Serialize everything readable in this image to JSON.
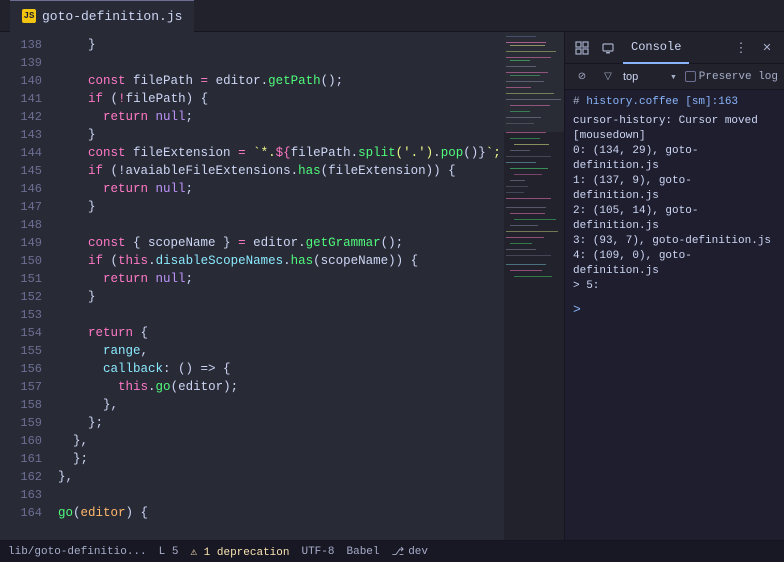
{
  "titlebar": {
    "tab_icon": "JS",
    "tab_label": "goto-definition.js"
  },
  "editor": {
    "lines": [
      {
        "num": 138,
        "tokens": [
          {
            "t": "    }",
            "c": "cb"
          }
        ]
      },
      {
        "num": 139,
        "tokens": []
      },
      {
        "num": 140,
        "tokens": [
          {
            "t": "    ",
            "c": ""
          },
          {
            "t": "const",
            "c": "kw"
          },
          {
            "t": " filePath ",
            "c": "var"
          },
          {
            "t": "=",
            "c": "op"
          },
          {
            "t": " editor",
            "c": "var"
          },
          {
            "t": ".",
            "c": "punc"
          },
          {
            "t": "getPath",
            "c": "fn"
          },
          {
            "t": "();",
            "c": "punc"
          }
        ]
      },
      {
        "num": 141,
        "tokens": [
          {
            "t": "    ",
            "c": ""
          },
          {
            "t": "if",
            "c": "kw"
          },
          {
            "t": " (",
            "c": "punc"
          },
          {
            "t": "!",
            "c": "op"
          },
          {
            "t": "filePath",
            "c": "var"
          },
          {
            "t": ") {",
            "c": "punc"
          }
        ]
      },
      {
        "num": 142,
        "tokens": [
          {
            "t": "      ",
            "c": ""
          },
          {
            "t": "return",
            "c": "kw"
          },
          {
            "t": " null",
            "c": "bool"
          },
          {
            "t": ";",
            "c": "punc"
          }
        ]
      },
      {
        "num": 143,
        "tokens": [
          {
            "t": "    }",
            "c": "cb"
          }
        ]
      },
      {
        "num": 144,
        "tokens": [
          {
            "t": "    ",
            "c": ""
          },
          {
            "t": "const",
            "c": "kw"
          },
          {
            "t": " fileExtension ",
            "c": "var"
          },
          {
            "t": "=",
            "c": "op"
          },
          {
            "t": " `*.",
            "c": "str"
          },
          {
            "t": "${",
            "c": "op"
          },
          {
            "t": "filePath",
            "c": "var"
          },
          {
            "t": ".",
            "c": "punc"
          },
          {
            "t": "split",
            "c": "fn"
          },
          {
            "t": "('.')",
            "c": "str"
          },
          {
            "t": ".",
            "c": "punc"
          },
          {
            "t": "pop",
            "c": "fn"
          },
          {
            "t": "()}",
            "c": "punc"
          },
          {
            "t": "`;",
            "c": "str"
          }
        ]
      },
      {
        "num": 145,
        "tokens": [
          {
            "t": "    ",
            "c": ""
          },
          {
            "t": "if",
            "c": "kw"
          },
          {
            "t": " (!",
            "c": "punc"
          },
          {
            "t": "avaiableFileExtensions",
            "c": "var"
          },
          {
            "t": ".",
            "c": "punc"
          },
          {
            "t": "has",
            "c": "fn"
          },
          {
            "t": "(",
            "c": "punc"
          },
          {
            "t": "fileExtension",
            "c": "var"
          },
          {
            "t": ")) {",
            "c": "punc"
          }
        ]
      },
      {
        "num": 146,
        "tokens": [
          {
            "t": "      ",
            "c": ""
          },
          {
            "t": "return",
            "c": "kw"
          },
          {
            "t": " null",
            "c": "bool"
          },
          {
            "t": ";",
            "c": "punc"
          }
        ]
      },
      {
        "num": 147,
        "tokens": [
          {
            "t": "    }",
            "c": "cb"
          }
        ]
      },
      {
        "num": 148,
        "tokens": []
      },
      {
        "num": 149,
        "tokens": [
          {
            "t": "    ",
            "c": ""
          },
          {
            "t": "const",
            "c": "kw"
          },
          {
            "t": " { scopeName } ",
            "c": "var"
          },
          {
            "t": "=",
            "c": "op"
          },
          {
            "t": " editor",
            "c": "var"
          },
          {
            "t": ".",
            "c": "punc"
          },
          {
            "t": "getGrammar",
            "c": "fn"
          },
          {
            "t": "();",
            "c": "punc"
          }
        ]
      },
      {
        "num": 150,
        "tokens": [
          {
            "t": "    ",
            "c": ""
          },
          {
            "t": "if",
            "c": "kw"
          },
          {
            "t": " (",
            "c": "punc"
          },
          {
            "t": "this",
            "c": "this-kw"
          },
          {
            "t": ".",
            "c": "punc"
          },
          {
            "t": "disableScopeNames",
            "c": "prop"
          },
          {
            "t": ".",
            "c": "punc"
          },
          {
            "t": "has",
            "c": "fn"
          },
          {
            "t": "(",
            "c": "punc"
          },
          {
            "t": "scopeName",
            "c": "var"
          },
          {
            "t": ")) {",
            "c": "punc"
          }
        ]
      },
      {
        "num": 151,
        "tokens": [
          {
            "t": "      ",
            "c": ""
          },
          {
            "t": "return",
            "c": "kw"
          },
          {
            "t": " null",
            "c": "bool"
          },
          {
            "t": ";",
            "c": "punc"
          }
        ]
      },
      {
        "num": 152,
        "tokens": [
          {
            "t": "    }",
            "c": "cb"
          }
        ]
      },
      {
        "num": 153,
        "tokens": []
      },
      {
        "num": 154,
        "tokens": [
          {
            "t": "    ",
            "c": ""
          },
          {
            "t": "return",
            "c": "kw"
          },
          {
            "t": " {",
            "c": "cb"
          }
        ]
      },
      {
        "num": 155,
        "tokens": [
          {
            "t": "      ",
            "c": ""
          },
          {
            "t": "range",
            "c": "prop"
          },
          {
            "t": ",",
            "c": "punc"
          }
        ]
      },
      {
        "num": 156,
        "tokens": [
          {
            "t": "      ",
            "c": ""
          },
          {
            "t": "callback",
            "c": "prop"
          },
          {
            "t": ": () => {",
            "c": "punc"
          }
        ]
      },
      {
        "num": 157,
        "tokens": [
          {
            "t": "        ",
            "c": ""
          },
          {
            "t": "this",
            "c": "this-kw"
          },
          {
            "t": ".",
            "c": "punc"
          },
          {
            "t": "go",
            "c": "fn"
          },
          {
            "t": "(",
            "c": "punc"
          },
          {
            "t": "editor",
            "c": "var"
          },
          {
            "t": ");",
            "c": "punc"
          }
        ]
      },
      {
        "num": 158,
        "tokens": [
          {
            "t": "      ",
            "c": ""
          },
          {
            "t": "},",
            "c": "cb"
          }
        ]
      },
      {
        "num": 159,
        "tokens": [
          {
            "t": "    ",
            "c": ""
          },
          {
            "t": "};",
            "c": "cb"
          }
        ]
      },
      {
        "num": 160,
        "tokens": [
          {
            "t": "  ",
            "c": ""
          },
          {
            "t": "},",
            "c": "cb"
          }
        ]
      },
      {
        "num": 161,
        "tokens": [
          {
            "t": "  ",
            "c": ""
          },
          {
            "t": "};",
            "c": "cb"
          }
        ]
      },
      {
        "num": 162,
        "tokens": [
          {
            "t": "},",
            "c": "cb"
          }
        ]
      },
      {
        "num": 163,
        "tokens": []
      },
      {
        "num": 164,
        "tokens": [
          {
            "t": "go",
            "c": "fn"
          },
          {
            "t": "(",
            "c": "punc"
          },
          {
            "t": "editor",
            "c": "param"
          },
          {
            "t": ") {",
            "c": "punc"
          }
        ]
      }
    ]
  },
  "devtools": {
    "toolbar": {
      "inspect_icon": "⊡",
      "device_icon": "▭",
      "console_tab": "Console",
      "more_icon": "⋮",
      "close_icon": "✕"
    },
    "filter": {
      "clear_icon": "🚫",
      "filter_icon": "▽",
      "filter_value": "top",
      "dropdown_arrow": "▾",
      "preserve_log_label": "Preserve log"
    },
    "console_output": {
      "source": "history.coffee [sm]:163",
      "hash": "#",
      "lines": [
        "cursor-history: Cursor moved",
        "[mousedown]",
        "  0: (134, 29), goto-definition.js",
        "  1: (137, 9), goto-definition.js",
        "  2: (105, 14), goto-definition.js",
        "  3: (93, 7), goto-definition.js",
        "  4: (109, 0), goto-definition.js",
        "> 5:"
      ]
    },
    "prompt": ">"
  },
  "statusbar": {
    "file_path": "lib/goto-definitio...",
    "line_col": "L 5",
    "warning": "⚠ 1 deprecation",
    "encoding": "UTF-8",
    "syntax": "Babel",
    "git_icon": "⎇",
    "git_branch": "dev"
  }
}
